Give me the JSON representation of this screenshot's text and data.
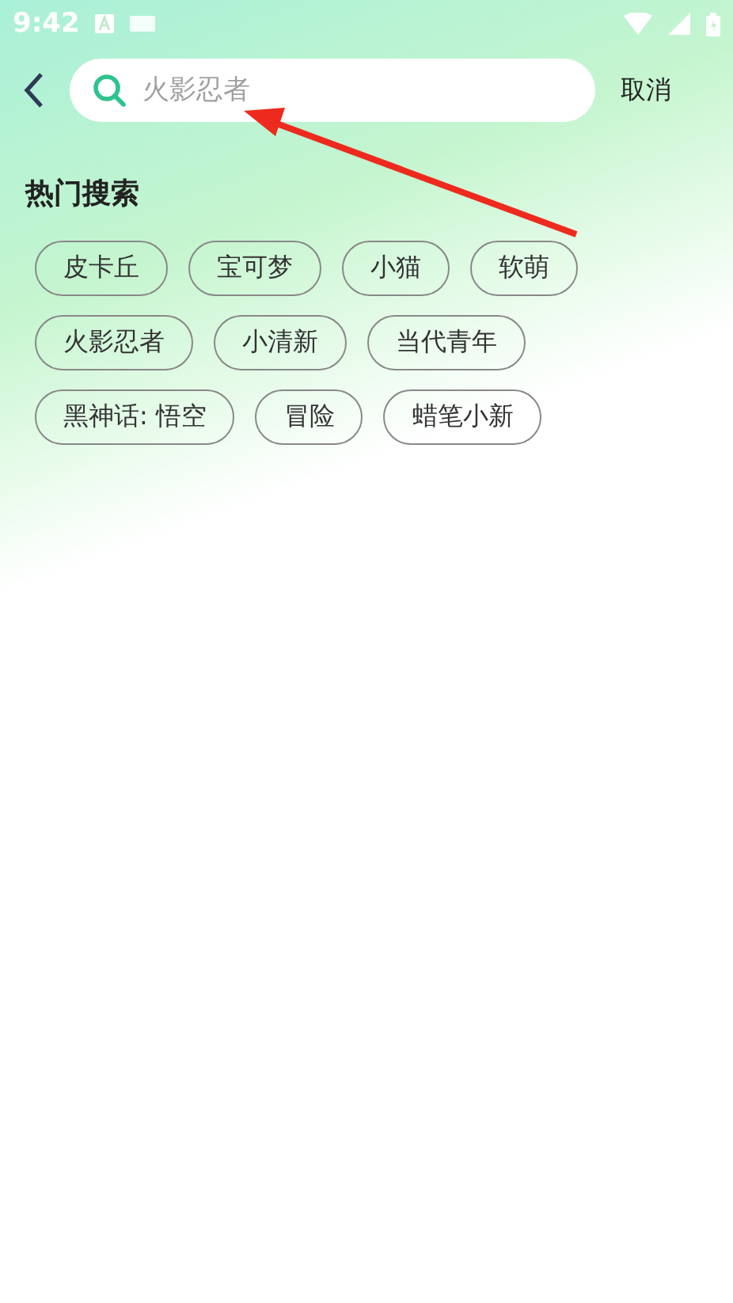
{
  "status_bar": {
    "time": "9:42"
  },
  "search_bar": {
    "placeholder": "火影忍者",
    "cancel": "取消"
  },
  "hot_searches": {
    "title": "热门搜索",
    "rows": [
      [
        "皮卡丘",
        "宝可梦",
        "小猫",
        "软萌"
      ],
      [
        "火影忍者",
        "小清新",
        "当代青年"
      ],
      [
        "黑神话: 悟空",
        "冒险",
        "蜡笔小新"
      ]
    ]
  }
}
